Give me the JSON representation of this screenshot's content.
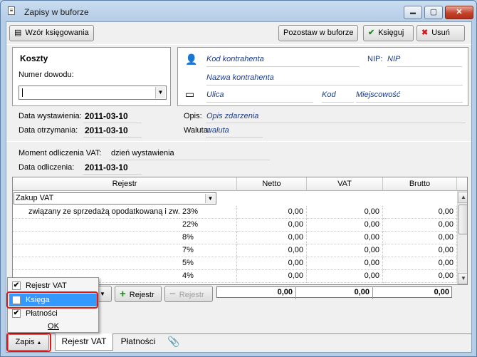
{
  "window": {
    "title": "Zapisy w buforze",
    "min_glyph": "▬",
    "max_glyph": "▢",
    "close_glyph": "✕"
  },
  "toolbar": {
    "template_label": "Wzór księgowania",
    "leave_label": "Pozostaw w buforze",
    "post_label": "Księguj",
    "delete_label": "Usuń"
  },
  "doc": {
    "type_title": "Koszty",
    "number_label": "Numer dowodu:",
    "number_value": "",
    "issue_label": "Data wystawienia:",
    "issue_value": "2011-03-10",
    "received_label": "Data otrzymania:",
    "received_value": "2011-03-10"
  },
  "contractor": {
    "code_placeholder": "Kod kontrahenta",
    "nip_label": "NIP:",
    "nip_placeholder": "NIP",
    "name_placeholder": "Nazwa kontrahenta",
    "street_placeholder": "Ulica",
    "postcode_placeholder": "Kod",
    "city_placeholder": "Miejscowość",
    "description_label": "Opis:",
    "description_placeholder": "Opis zdarzenia",
    "currency_label": "Waluta:",
    "currency_placeholder": "waluta"
  },
  "vat": {
    "moment_label": "Moment odliczenia VAT:",
    "moment_value": "dzień wystawienia",
    "deduct_label": "Data odliczenia:",
    "deduct_value": "2011-03-10"
  },
  "grid": {
    "headers": [
      "Rejestr",
      "Netto",
      "VAT",
      "Brutto"
    ],
    "register_value": "Zakup VAT",
    "desc": "związany ze sprzedażą opodatkowaną i zw...",
    "rows": [
      {
        "rate": "23%",
        "netto": "0,00",
        "vat": "0,00",
        "brutto": "0,00"
      },
      {
        "rate": "22%",
        "netto": "0,00",
        "vat": "0,00",
        "brutto": "0,00"
      },
      {
        "rate": "8%",
        "netto": "0,00",
        "vat": "0,00",
        "brutto": "0,00"
      },
      {
        "rate": "7%",
        "netto": "0,00",
        "vat": "0,00",
        "brutto": "0,00"
      },
      {
        "rate": "5%",
        "netto": "0,00",
        "vat": "0,00",
        "brutto": "0,00"
      },
      {
        "rate": "4%",
        "netto": "0,00",
        "vat": "0,00",
        "brutto": "0,00"
      }
    ],
    "totals": {
      "netto": "0,00",
      "vat": "0,00",
      "brutto": "0,00"
    },
    "add_register_label": "Rejestr",
    "remove_register_label": "Rejestr"
  },
  "popup_menu": {
    "items": [
      {
        "label": "Rejestr VAT",
        "checked": true
      },
      {
        "label": "Księga",
        "checked": false
      },
      {
        "label": "Płatności",
        "checked": true
      }
    ],
    "ok_label": "OK"
  },
  "tabs": {
    "zapis_label": "Zapis",
    "rejestr_vat_label": "Rejestr VAT",
    "platnosci_label": "Płatności"
  },
  "colors": {
    "highlight": "#3399ff",
    "callout": "#e01818",
    "window_frame": "#bcd3ea"
  }
}
